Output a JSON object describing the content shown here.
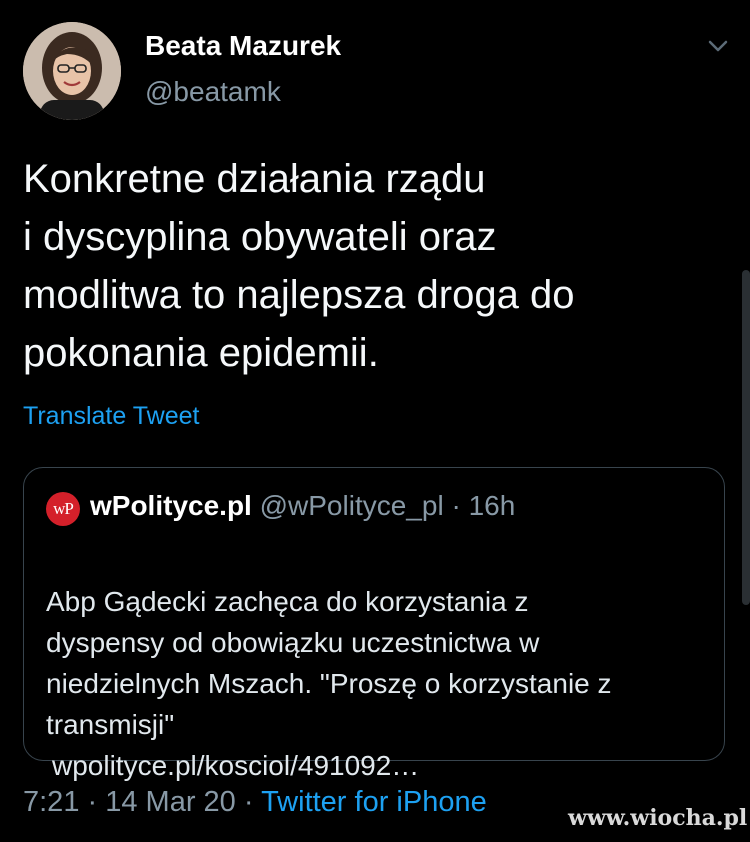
{
  "author": {
    "name": "Beata Mazurek",
    "handle": "@beatamk"
  },
  "tweet": {
    "text": "Konkretne działania rządu\ni dyscyplina obywateli oraz\nmodlitwa to najlepsza droga do\npokonania epidemii.",
    "translate_label": "Translate Tweet"
  },
  "quoted_tweet": {
    "logo_text": "wP",
    "name": "wPolityce.pl",
    "handle": "@wPolityce_pl",
    "separator": " · ",
    "time": "16h",
    "text": "Abp Gądecki zachęca do korzystania z\ndyspensy od obowiązku uczestnictwa w\nniedzielnych Mszach. \"Proszę o korzystanie z\ntransmisji\"",
    "link": "wpolityce.pl/kosciol/491092…"
  },
  "footer": {
    "time": "7:21",
    "separator": " · ",
    "date": "14 Mar 20",
    "source": "Twitter for iPhone"
  },
  "watermark": "www.wiocha.pl",
  "colors": {
    "background": "#000000",
    "accent": "#1da1f2",
    "secondary_text": "#8899a6",
    "border": "#38444d",
    "logo_red": "#d4202a"
  },
  "icons": {
    "chevron": "chevron-down-icon",
    "avatar": "avatar"
  }
}
